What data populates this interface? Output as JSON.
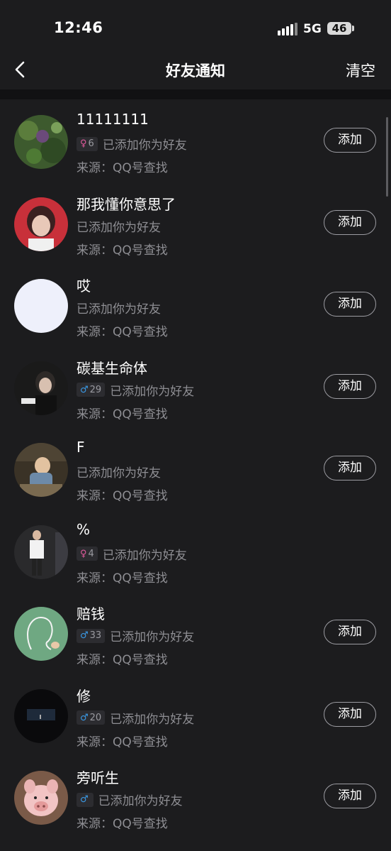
{
  "status_bar": {
    "time": "12:46",
    "network": "5G",
    "battery": "46"
  },
  "nav": {
    "title": "好友通知",
    "clear_label": "清空"
  },
  "friends": [
    {
      "name": "11111111",
      "gender": "female",
      "gender_icon": "♀",
      "age": "6",
      "message": "已添加你为好友",
      "source": "来源：QQ号查找",
      "button": "添加",
      "avatar": "plant-photo-avatar"
    },
    {
      "name": "那我懂你意思了",
      "gender": "",
      "gender_icon": "",
      "age": "",
      "message": "已添加你为好友",
      "source": "来源：QQ号查找",
      "button": "添加",
      "avatar": "red-hair-person-avatar"
    },
    {
      "name": "哎",
      "gender": "",
      "gender_icon": "",
      "age": "",
      "message": "已添加你为好友",
      "source": "来源：QQ号查找",
      "button": "添加",
      "avatar": "blank-avatar"
    },
    {
      "name": "碳基生命体",
      "gender": "male",
      "gender_icon": "♂",
      "age": "29",
      "message": "已添加你为好友",
      "source": "来源：QQ号查找",
      "button": "添加",
      "avatar": "dark-person-avatar"
    },
    {
      "name": "F",
      "gender": "",
      "gender_icon": "",
      "age": "",
      "message": "已添加你为好友",
      "source": "来源：QQ号查找",
      "button": "添加",
      "avatar": "child-on-car-avatar"
    },
    {
      "name": "%",
      "gender": "female",
      "gender_icon": "♀",
      "age": "4",
      "message": "已添加你为好友",
      "source": "来源：QQ号查找",
      "button": "",
      "avatar": "standing-person-avatar"
    },
    {
      "name": "赔钱",
      "gender": "male",
      "gender_icon": "♂",
      "age": "33",
      "message": "已添加你为好友",
      "source": "来源：QQ号查找",
      "button": "添加",
      "avatar": "chalk-drawing-avatar"
    },
    {
      "name": "修",
      "gender": "male",
      "gender_icon": "♂",
      "age": "20",
      "message": "已添加你为好友",
      "source": "来源：QQ号查找",
      "button": "添加",
      "avatar": "dark-scene-avatar"
    },
    {
      "name": "旁听生",
      "gender": "male",
      "gender_icon": "♂",
      "age": "",
      "message": "已添加你为好友",
      "source": "来源：QQ号查找",
      "button": "添加",
      "avatar": "piglet-avatar"
    }
  ]
}
